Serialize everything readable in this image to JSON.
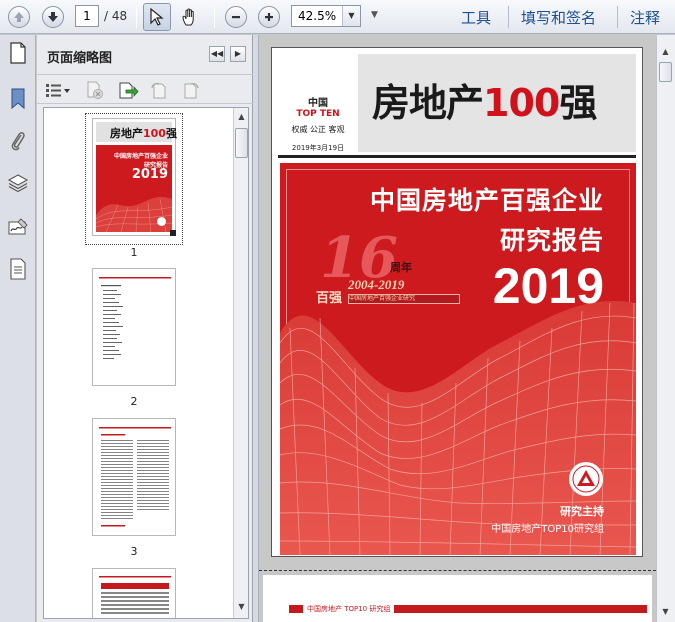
{
  "toolbar": {
    "current_page": "1",
    "total_pages": "/ 48",
    "zoom": "42.5%",
    "menu": [
      "工具",
      "填写和签名",
      "注释"
    ]
  },
  "panel": {
    "title": "页面缩略图",
    "thumbnails": [
      {
        "label": "1"
      },
      {
        "label": "2"
      },
      {
        "label": "3"
      }
    ]
  },
  "cover": {
    "hdr_china": "中国",
    "hdr_topten": "TOP TEN",
    "hdr_motto": "权威 公正 客观",
    "hdr_date": "2019年3月19日",
    "title_black": "房地产",
    "title_red": "100",
    "title_black2": "强",
    "report_line1": "中国房地产百强企业",
    "report_line2": "研究报告",
    "report_year": "2019",
    "anniv_num": "16",
    "anniv_suffix": "周年",
    "anniv_range": "2004-2019",
    "anniv_badge": "百强",
    "anniv_text": "中国房地产百强企业研究",
    "host_label": "研究主持",
    "host_name": "中国房地产TOP10研究组"
  },
  "page2": {
    "header_text": "中国房地产 TOP10 研究组"
  },
  "thumb1": {
    "title_black": "房地产",
    "title_red": "100",
    "title_black2": "强",
    "line1": "中国房地产百强企业",
    "line2": "研究报告",
    "year": "2019"
  }
}
